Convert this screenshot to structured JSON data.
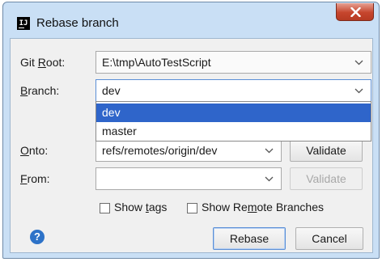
{
  "window": {
    "title": "Rebase branch",
    "app_icon_text": "IJ",
    "close_icon": "close-x-icon"
  },
  "form": {
    "git_root": {
      "label_pre": "Git ",
      "label_mnemonic": "R",
      "label_post": "oot:",
      "value": "E:\\tmp\\AutoTestScript"
    },
    "branch": {
      "label_mnemonic": "B",
      "label_post": "ranch:",
      "value": "dev",
      "options": [
        "dev",
        "master"
      ],
      "selected_index": 0
    },
    "onto": {
      "label_mnemonic": "O",
      "label_post": "nto:",
      "value": "refs/remotes/origin/dev",
      "validate_label": "Validate"
    },
    "from": {
      "label_mnemonic": "F",
      "label_post": "rom:",
      "value": "",
      "validate_label": "Validate"
    },
    "show_tags": {
      "label_pre": "Show ",
      "label_mnemonic": "t",
      "label_post": "ags",
      "checked": false
    },
    "show_remote": {
      "label_pre": "Show Re",
      "label_mnemonic": "m",
      "label_post": "ote Branches",
      "checked": false
    }
  },
  "footer": {
    "help_glyph": "?",
    "rebase_label": "Rebase",
    "cancel_label": "Cancel"
  },
  "colors": {
    "title_bar": "#c9dff5",
    "selection": "#2f65ca",
    "close_button": "#c6452d",
    "help_icon": "#2d72c8"
  }
}
